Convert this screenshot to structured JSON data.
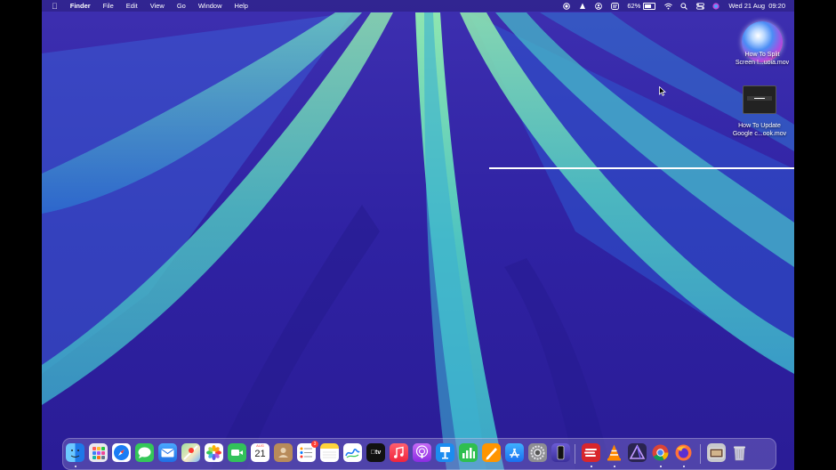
{
  "menubar": {
    "apple": "",
    "app_name": "Finder",
    "menus": [
      "File",
      "Edit",
      "View",
      "Go",
      "Window",
      "Help"
    ],
    "battery_percent": "62%",
    "battery_level": 0.62,
    "datetime": "Wed 21 Aug  09:20",
    "status_icons": [
      "screen-record-icon",
      "vlc-cone-icon",
      "user-icon",
      "expressvpn-icon",
      "battery-icon",
      "wifi-icon",
      "spotlight-search-icon",
      "control-center-icon",
      "siri-icon"
    ]
  },
  "desktop": {
    "files": [
      {
        "line1": "How To Split",
        "line2": "Screen I...uoia.mov",
        "icon": "siri-thumbnail-icon"
      },
      {
        "line1": "How To Update",
        "line2": "Google c...ook.mov",
        "icon": "video-thumbnail-icon"
      }
    ]
  },
  "dock": {
    "calendar_month": "AUG",
    "calendar_day": "21",
    "reminders_badge": "3",
    "appletv_label": "tv",
    "apps": [
      "finder",
      "launchpad",
      "safari",
      "messages",
      "mail",
      "maps",
      "photos",
      "facetime",
      "calendar",
      "contacts",
      "reminders",
      "notes",
      "freeform",
      "apple-tv",
      "music",
      "podcasts",
      "keynote",
      "numbers",
      "pages",
      "app-store",
      "system-settings",
      "iphone-mirroring",
      "expressvpn",
      "vlc",
      "affinity-designer",
      "chrome",
      "firefox",
      "screenshots",
      "trash"
    ],
    "colors": {
      "finder": "#1e8cf0",
      "safari": "#1a7cf5",
      "messages": "#34c759",
      "mail": "#2f88f0",
      "facetime": "#32c25a",
      "music": "#fa3c4c",
      "podcasts": "#a24ee0",
      "keynote": "#1c8cf0",
      "numbers": "#2fbf4f",
      "pages": "#ff9500",
      "app-store": "#1a8cf7",
      "expressvpn": "#d8262c",
      "vlc": "#ff8800"
    }
  }
}
